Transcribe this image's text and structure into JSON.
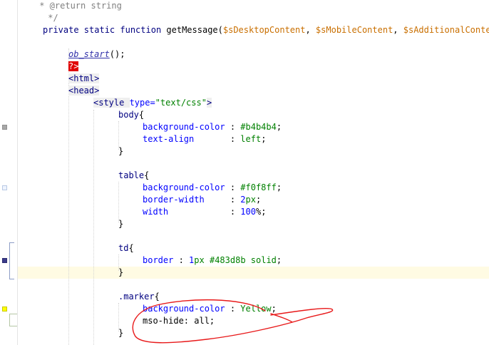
{
  "editor": {
    "lines": [
      {
        "id": "l1",
        "tokens": [
          [
            "cmt",
            " * @return string"
          ]
        ]
      },
      {
        "id": "l2",
        "tokens": [
          [
            "cmt",
            " */"
          ]
        ]
      },
      {
        "id": "l3",
        "tokens": [
          [
            "kw",
            "private static function "
          ],
          [
            "fn",
            "getMessage("
          ],
          [
            "var",
            "$sDesktopContent"
          ],
          [
            "plain",
            ", "
          ],
          [
            "var",
            "$sMobileContent"
          ],
          [
            "plain",
            ", "
          ],
          [
            "var",
            "$sAdditionalContent"
          ]
        ]
      },
      {
        "id": "l4",
        "tokens": []
      },
      {
        "id": "l5",
        "tokens": [
          [
            "call",
            "ob_start"
          ],
          [
            "plain",
            "();"
          ]
        ]
      },
      {
        "id": "l6",
        "tokens": [
          [
            "phptag",
            "?>"
          ]
        ]
      },
      {
        "id": "l7",
        "tokens": [
          [
            "tag",
            "<html>"
          ]
        ]
      },
      {
        "id": "l8",
        "tokens": [
          [
            "tag",
            "<head>"
          ]
        ]
      },
      {
        "id": "l9",
        "tokens": [
          [
            "tag",
            "<style "
          ],
          [
            "attr",
            "type="
          ],
          [
            "str",
            "\"text/css\""
          ],
          [
            "tag",
            ">"
          ]
        ]
      },
      {
        "id": "l10",
        "tokens": [
          [
            "sel",
            "body"
          ],
          [
            "plain",
            "{"
          ]
        ]
      },
      {
        "id": "l11",
        "tokens": [
          [
            "prop",
            "background-color"
          ],
          [
            "plain",
            " : "
          ],
          [
            "val",
            "#b4b4b4"
          ],
          [
            "plain",
            ";"
          ]
        ]
      },
      {
        "id": "l12",
        "tokens": [
          [
            "prop",
            "text-align"
          ],
          [
            "plain",
            "       : "
          ],
          [
            "val",
            "left"
          ],
          [
            "plain",
            ";"
          ]
        ]
      },
      {
        "id": "l13",
        "tokens": [
          [
            "plain",
            "}"
          ]
        ]
      },
      {
        "id": "l14",
        "tokens": []
      },
      {
        "id": "l15",
        "tokens": [
          [
            "sel",
            "table"
          ],
          [
            "plain",
            "{"
          ]
        ]
      },
      {
        "id": "l16",
        "tokens": [
          [
            "prop",
            "background-color"
          ],
          [
            "plain",
            " : "
          ],
          [
            "val",
            "#f0f8ff"
          ],
          [
            "plain",
            ";"
          ]
        ]
      },
      {
        "id": "l17",
        "tokens": [
          [
            "prop",
            "border-width"
          ],
          [
            "plain",
            "     : "
          ],
          [
            "num",
            "2"
          ],
          [
            "val",
            "px"
          ],
          [
            "plain",
            ";"
          ]
        ]
      },
      {
        "id": "l18",
        "tokens": [
          [
            "prop",
            "width"
          ],
          [
            "plain",
            "            : "
          ],
          [
            "num",
            "100"
          ],
          [
            "plain",
            "%;"
          ]
        ]
      },
      {
        "id": "l19",
        "tokens": [
          [
            "plain",
            "}"
          ]
        ]
      },
      {
        "id": "l20",
        "tokens": []
      },
      {
        "id": "l21",
        "tokens": [
          [
            "sel",
            "td"
          ],
          [
            "plain",
            "{"
          ]
        ]
      },
      {
        "id": "l22",
        "tokens": [
          [
            "prop",
            "border"
          ],
          [
            "plain",
            " : "
          ],
          [
            "num",
            "1"
          ],
          [
            "val",
            "px "
          ],
          [
            "val",
            "#483d8b solid"
          ],
          [
            "plain",
            ";"
          ]
        ]
      },
      {
        "id": "l23",
        "tokens": [
          [
            "plain",
            "}"
          ]
        ]
      },
      {
        "id": "l24",
        "tokens": []
      },
      {
        "id": "l25",
        "tokens": [
          [
            "sel",
            ".marker"
          ],
          [
            "plain",
            "{"
          ]
        ]
      },
      {
        "id": "l26",
        "tokens": [
          [
            "prop",
            "background-color"
          ],
          [
            "plain",
            " : "
          ],
          [
            "val",
            "Yellow"
          ],
          [
            "plain",
            ";"
          ]
        ]
      },
      {
        "id": "l27",
        "tokens": [
          [
            "plain",
            "mso-hide: all;"
          ]
        ]
      },
      {
        "id": "l28",
        "tokens": [
          [
            "plain",
            "}"
          ]
        ]
      }
    ]
  },
  "colors": {
    "annotation_stroke": "#e8191a",
    "current_line": "#fffbe3"
  }
}
